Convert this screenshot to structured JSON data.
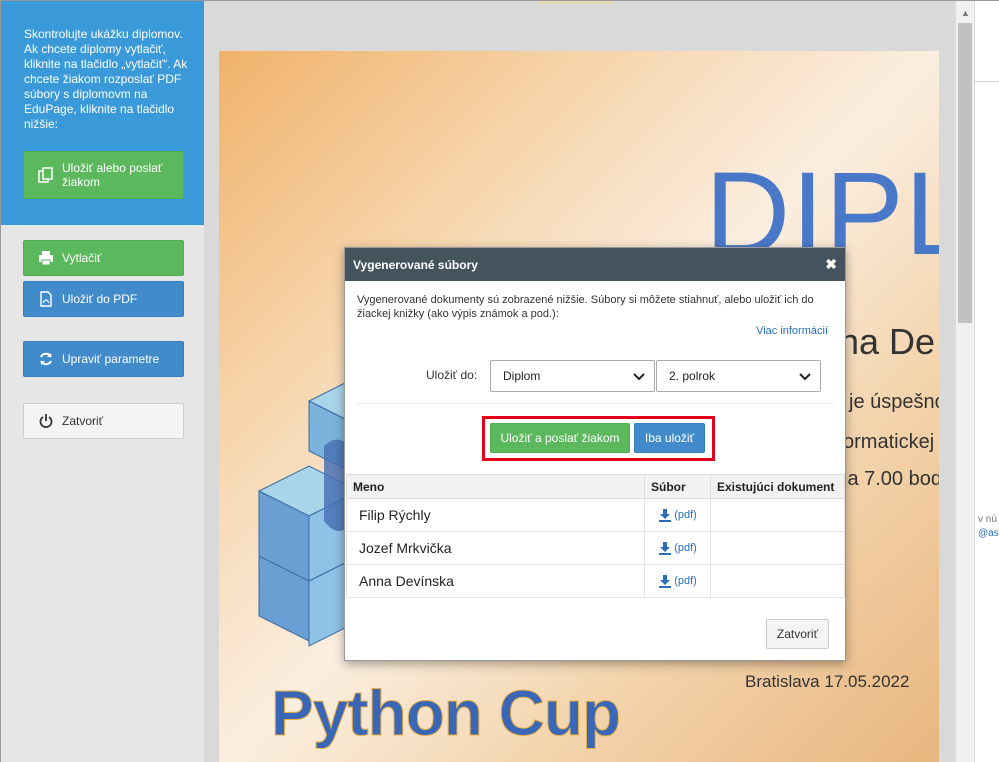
{
  "sidebar": {
    "info_text": "Skontrolujte ukážku diplomov. Ak chcete diplomy vytlačiť, kliknite na tlačidlo „vytlačiť“. Ak chcete žiakom rozposlať PDF súbory s diplomovm na EduPage, kliknite na tlačidlo nižšie:",
    "save_send_label": "Uložiť alebo poslať žiakom",
    "print_label": "Vytlačiť",
    "save_pdf_label": "Uložiť do PDF",
    "edit_params_label": "Upraviť parametre",
    "close_label": "Zatvoriť"
  },
  "diploma": {
    "title": "DIPL",
    "name": "na De",
    "line1": "je úspešno",
    "line2": "ormatickej s",
    "line3": "la 7.00 bod",
    "place_date": "Bratislava 17.05.2022",
    "logo": "Python Cup"
  },
  "right_strip": {
    "text1": "v nú",
    "text2": "@as"
  },
  "modal": {
    "title": "Vygenerované súbory",
    "description": "Vygenerované dokumenty sú zobrazené nižšie. Súbory si môžete stiahnuť, alebo uložiť ich do žiackej knižky (ako výpis známok a pod.):",
    "more_info": "Viac informácií",
    "save_to_label": "Uložiť do:",
    "select_type": "Diplom",
    "select_period": "2. polrok",
    "send_button": "Uložiť a poslať žiakom",
    "save_only_button": "Iba uložiť",
    "table": {
      "headers": [
        "Meno",
        "Súbor",
        "Existujúci dokument"
      ],
      "rows": [
        {
          "name": "Filip Rýchly",
          "file": "(pdf)",
          "existing": ""
        },
        {
          "name": "Jozef Mrkvička",
          "file": "(pdf)",
          "existing": ""
        },
        {
          "name": "Anna Devínska",
          "file": "(pdf)",
          "existing": ""
        }
      ]
    },
    "close_button": "Zatvoriť"
  },
  "colors": {
    "sidebar_blue": "#3a9ad9",
    "green": "#5cb85c",
    "blue": "#428bca",
    "highlight_red": "#e3001b",
    "modal_header": "#45535c"
  }
}
